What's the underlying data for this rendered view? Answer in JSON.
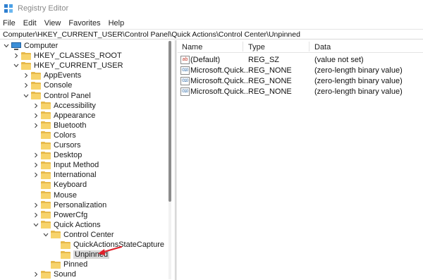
{
  "window": {
    "title": "Registry Editor"
  },
  "menu": [
    "File",
    "Edit",
    "View",
    "Favorites",
    "Help"
  ],
  "address": "Computer\\HKEY_CURRENT_USER\\Control Panel\\Quick Actions\\Control Center\\Unpinned",
  "tree": [
    {
      "label": "Computer",
      "chevron": "down",
      "icon": "computer"
    },
    {
      "label": "HKEY_CLASSES_ROOT",
      "chevron": "right",
      "icon": "folder"
    },
    {
      "label": "HKEY_CURRENT_USER",
      "chevron": "down",
      "icon": "folder"
    },
    {
      "label": "AppEvents",
      "chevron": "right",
      "icon": "folder"
    },
    {
      "label": "Console",
      "chevron": "right",
      "icon": "folder"
    },
    {
      "label": "Control Panel",
      "chevron": "down",
      "icon": "folder"
    },
    {
      "label": "Accessibility",
      "chevron": "right",
      "icon": "folder"
    },
    {
      "label": "Appearance",
      "chevron": "right",
      "icon": "folder"
    },
    {
      "label": "Bluetooth",
      "chevron": "right",
      "icon": "folder"
    },
    {
      "label": "Colors",
      "chevron": "none",
      "icon": "folder"
    },
    {
      "label": "Cursors",
      "chevron": "none",
      "icon": "folder"
    },
    {
      "label": "Desktop",
      "chevron": "right",
      "icon": "folder"
    },
    {
      "label": "Input Method",
      "chevron": "right",
      "icon": "folder"
    },
    {
      "label": "International",
      "chevron": "right",
      "icon": "folder"
    },
    {
      "label": "Keyboard",
      "chevron": "none",
      "icon": "folder"
    },
    {
      "label": "Mouse",
      "chevron": "none",
      "icon": "folder"
    },
    {
      "label": "Personalization",
      "chevron": "right",
      "icon": "folder"
    },
    {
      "label": "PowerCfg",
      "chevron": "right",
      "icon": "folder"
    },
    {
      "label": "Quick Actions",
      "chevron": "down",
      "icon": "folder"
    },
    {
      "label": "Control Center",
      "chevron": "down",
      "icon": "folder"
    },
    {
      "label": "QuickActionsStateCapture",
      "chevron": "none",
      "icon": "folder"
    },
    {
      "label": "Unpinned",
      "chevron": "none",
      "icon": "folder",
      "selected": true
    },
    {
      "label": "Pinned",
      "chevron": "none",
      "icon": "folder"
    },
    {
      "label": "Sound",
      "chevron": "right",
      "icon": "folder"
    }
  ],
  "list": {
    "columns": [
      "Name",
      "Type",
      "Data"
    ],
    "rows": [
      {
        "icon": "string-value-icon",
        "name": "(Default)",
        "type": "REG_SZ",
        "data": "(value not set)"
      },
      {
        "icon": "binary-value-icon",
        "name": "Microsoft.Quick...",
        "type": "REG_NONE",
        "data": "(zero-length binary value)"
      },
      {
        "icon": "binary-value-icon",
        "name": "Microsoft.Quick...",
        "type": "REG_NONE",
        "data": "(zero-length binary value)"
      },
      {
        "icon": "binary-value-icon",
        "name": "Microsoft.Quick...",
        "type": "REG_NONE",
        "data": "(zero-length binary value)"
      }
    ]
  },
  "colors": {
    "annotation_arrow": "#e0202a",
    "folder": "#f7d36b",
    "selection": "#d9d9d9"
  }
}
